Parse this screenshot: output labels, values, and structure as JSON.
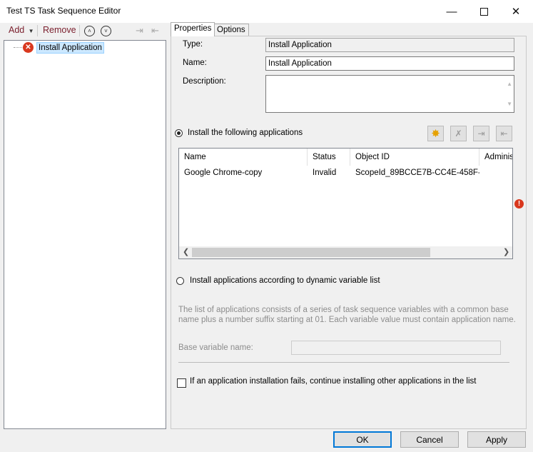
{
  "window": {
    "title": "Test TS Task Sequence Editor"
  },
  "toolbar": {
    "add": "Add",
    "remove": "Remove"
  },
  "tree": {
    "items": [
      {
        "label": "Install Application"
      }
    ]
  },
  "tabs": [
    {
      "label": "Properties"
    },
    {
      "label": "Options"
    }
  ],
  "properties": {
    "type_label": "Type:",
    "type_value": "Install Application",
    "name_label": "Name:",
    "name_value": "Install Application",
    "description_label": "Description:",
    "description_value": "",
    "radio_install_following": "Install the following applications",
    "radio_dynamic": "Install applications according to dynamic variable list",
    "dynamic_help": "The list of applications consists of a series of task sequence variables with a common base name plus a number suffix starting at 01. Each variable value must contain application name.",
    "base_variable_label": "Base variable name:",
    "base_variable_value": "",
    "continue_checkbox": "If an application installation fails, continue installing other applications in the list"
  },
  "apps_table": {
    "columns": [
      "Name",
      "Status",
      "Object ID",
      "Administ"
    ],
    "rows": [
      {
        "name": "Google Chrome-copy",
        "status": "Invalid",
        "object_id": "ScopeId_89BCCE7B-CC4E-458F-..."
      }
    ]
  },
  "buttons": {
    "ok": "OK",
    "cancel": "Cancel",
    "apply": "Apply"
  },
  "colors": {
    "accent": "#0078d7",
    "error": "#d9381e",
    "link": "#7a1e2c"
  }
}
